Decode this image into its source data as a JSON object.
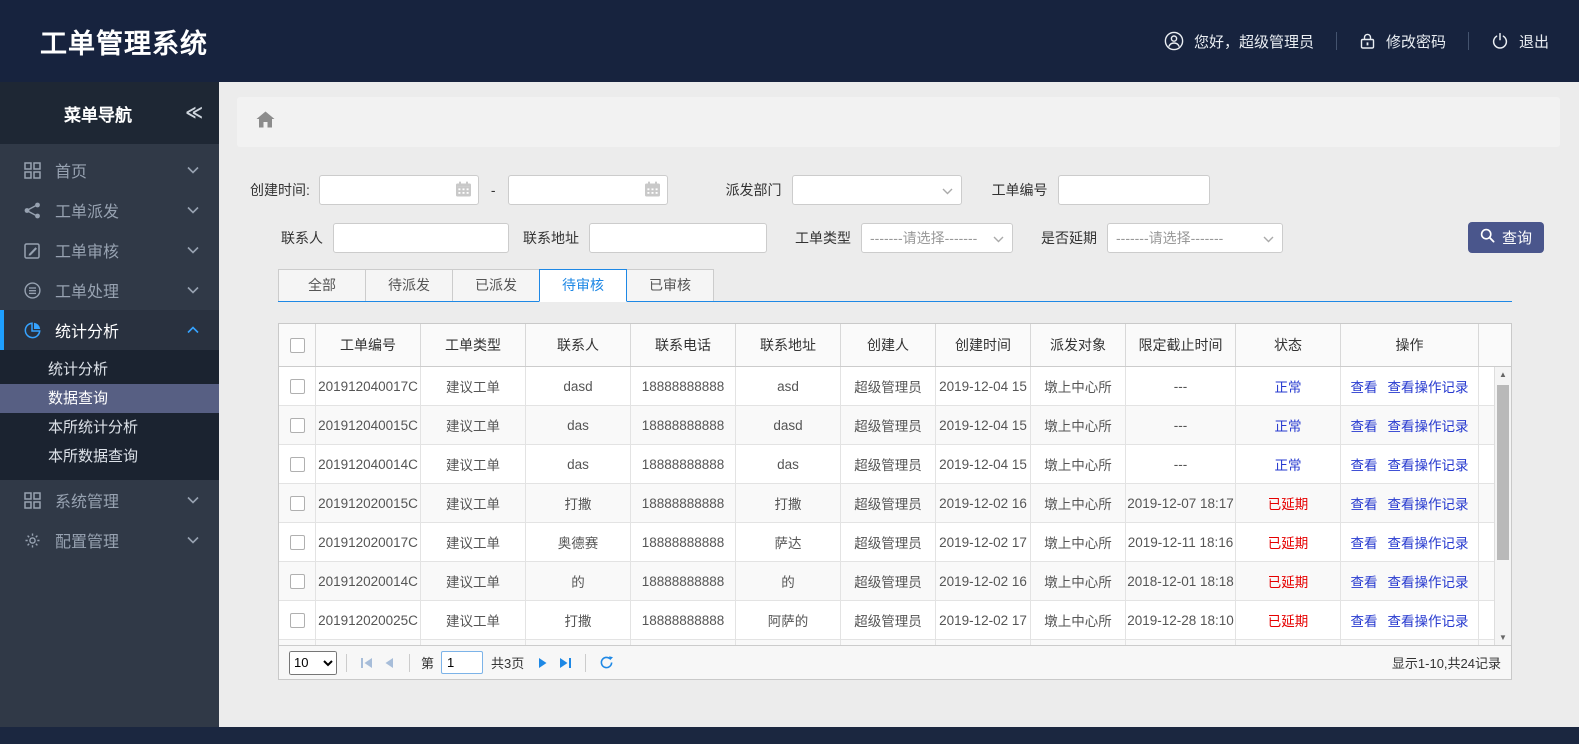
{
  "header": {
    "title": "工单管理系统",
    "greeting": "您好，超级管理员",
    "change_password": "修改密码",
    "logout": "退出"
  },
  "sidebar": {
    "title": "菜单导航",
    "collapse_glyph": "≪",
    "items": [
      {
        "label": "首页",
        "icon": "dashboard-grid-icon"
      },
      {
        "label": "工单派发",
        "icon": "share-icon"
      },
      {
        "label": "工单审核",
        "icon": "edit-icon"
      },
      {
        "label": "工单处理",
        "icon": "process-icon"
      },
      {
        "label": "统计分析",
        "icon": "pie-chart-icon",
        "active": true,
        "expanded": true,
        "children": [
          {
            "label": "统计分析"
          },
          {
            "label": "数据查询",
            "selected": true
          },
          {
            "label": "本所统计分析"
          },
          {
            "label": "本所数据查询"
          }
        ]
      },
      {
        "label": "系统管理",
        "icon": "modules-grid-icon"
      },
      {
        "label": "配置管理",
        "icon": "gear-icon"
      }
    ]
  },
  "filters": {
    "created_time_label": "创建时间:",
    "range_separator": "-",
    "dispatch_dept_label": "派发部门",
    "order_no_label": "工单编号",
    "contact_label": "联系人",
    "address_label": "联系地址",
    "order_type_label": "工单类型",
    "order_type_placeholder": "-------请选择-------",
    "delay_label": "是否延期",
    "delay_placeholder": "-------请选择-------",
    "search_button": "查询"
  },
  "tabs": [
    {
      "label": "全部"
    },
    {
      "label": "待派发"
    },
    {
      "label": "已派发"
    },
    {
      "label": "待审核",
      "active": true
    },
    {
      "label": "已审核"
    }
  ],
  "table": {
    "columns": [
      "工单编号",
      "工单类型",
      "联系人",
      "联系电话",
      "联系地址",
      "创建人",
      "创建时间",
      "派发对象",
      "限定截止时间",
      "状态",
      "操作"
    ],
    "action_labels": [
      "查看",
      "查看操作记录"
    ],
    "rows": [
      {
        "order_no": "201912040017C",
        "type": "建议工单",
        "contact": "dasd",
        "phone": "18888888888",
        "address": "asd",
        "creator": "超级管理员",
        "created": "2019-12-04 15",
        "target": "墩上中心所",
        "deadline": "---",
        "status": "正常",
        "delayed": false
      },
      {
        "order_no": "201912040015C",
        "type": "建议工单",
        "contact": "das",
        "phone": "18888888888",
        "address": "dasd",
        "creator": "超级管理员",
        "created": "2019-12-04 15",
        "target": "墩上中心所",
        "deadline": "---",
        "status": "正常",
        "delayed": false
      },
      {
        "order_no": "201912040014C",
        "type": "建议工单",
        "contact": "das",
        "phone": "18888888888",
        "address": "das",
        "creator": "超级管理员",
        "created": "2019-12-04 15",
        "target": "墩上中心所",
        "deadline": "---",
        "status": "正常",
        "delayed": false
      },
      {
        "order_no": "201912020015C",
        "type": "建议工单",
        "contact": "打撒",
        "phone": "18888888888",
        "address": "打撒",
        "creator": "超级管理员",
        "created": "2019-12-02 16",
        "target": "墩上中心所",
        "deadline": "2019-12-07 18:17",
        "status": "已延期",
        "delayed": true
      },
      {
        "order_no": "201912020017C",
        "type": "建议工单",
        "contact": "奥德赛",
        "phone": "18888888888",
        "address": "萨达",
        "creator": "超级管理员",
        "created": "2019-12-02 17",
        "target": "墩上中心所",
        "deadline": "2019-12-11 18:16",
        "status": "已延期",
        "delayed": true
      },
      {
        "order_no": "201912020014C",
        "type": "建议工单",
        "contact": "的",
        "phone": "18888888888",
        "address": "的",
        "creator": "超级管理员",
        "created": "2019-12-02 16",
        "target": "墩上中心所",
        "deadline": "2018-12-01 18:18",
        "status": "已延期",
        "delayed": true
      },
      {
        "order_no": "201912020025C",
        "type": "建议工单",
        "contact": "打撒",
        "phone": "18888888888",
        "address": "阿萨的",
        "creator": "超级管理员",
        "created": "2019-12-02 17",
        "target": "墩上中心所",
        "deadline": "2019-12-28 18:10",
        "status": "已延期",
        "delayed": true
      },
      {
        "order_no": "",
        "type": "",
        "contact": "",
        "phone": "",
        "address": "",
        "creator": "",
        "created": "",
        "target": "",
        "deadline": "",
        "status": "",
        "delayed": false,
        "partial": true
      }
    ]
  },
  "pagination": {
    "page_size": "10",
    "page_prefix": "第",
    "current_page": "1",
    "total_pages_label": "共3页",
    "summary": "显示1-10,共24记录"
  },
  "colors": {
    "header_bg": "#17233e",
    "sidebar_bg": "#303947",
    "accent_blue": "#1e88e5",
    "link_blue": "#2639cf",
    "danger_red": "#e60000",
    "search_button_bg": "#4a568c",
    "submenu_selected_bg": "#575f83"
  }
}
